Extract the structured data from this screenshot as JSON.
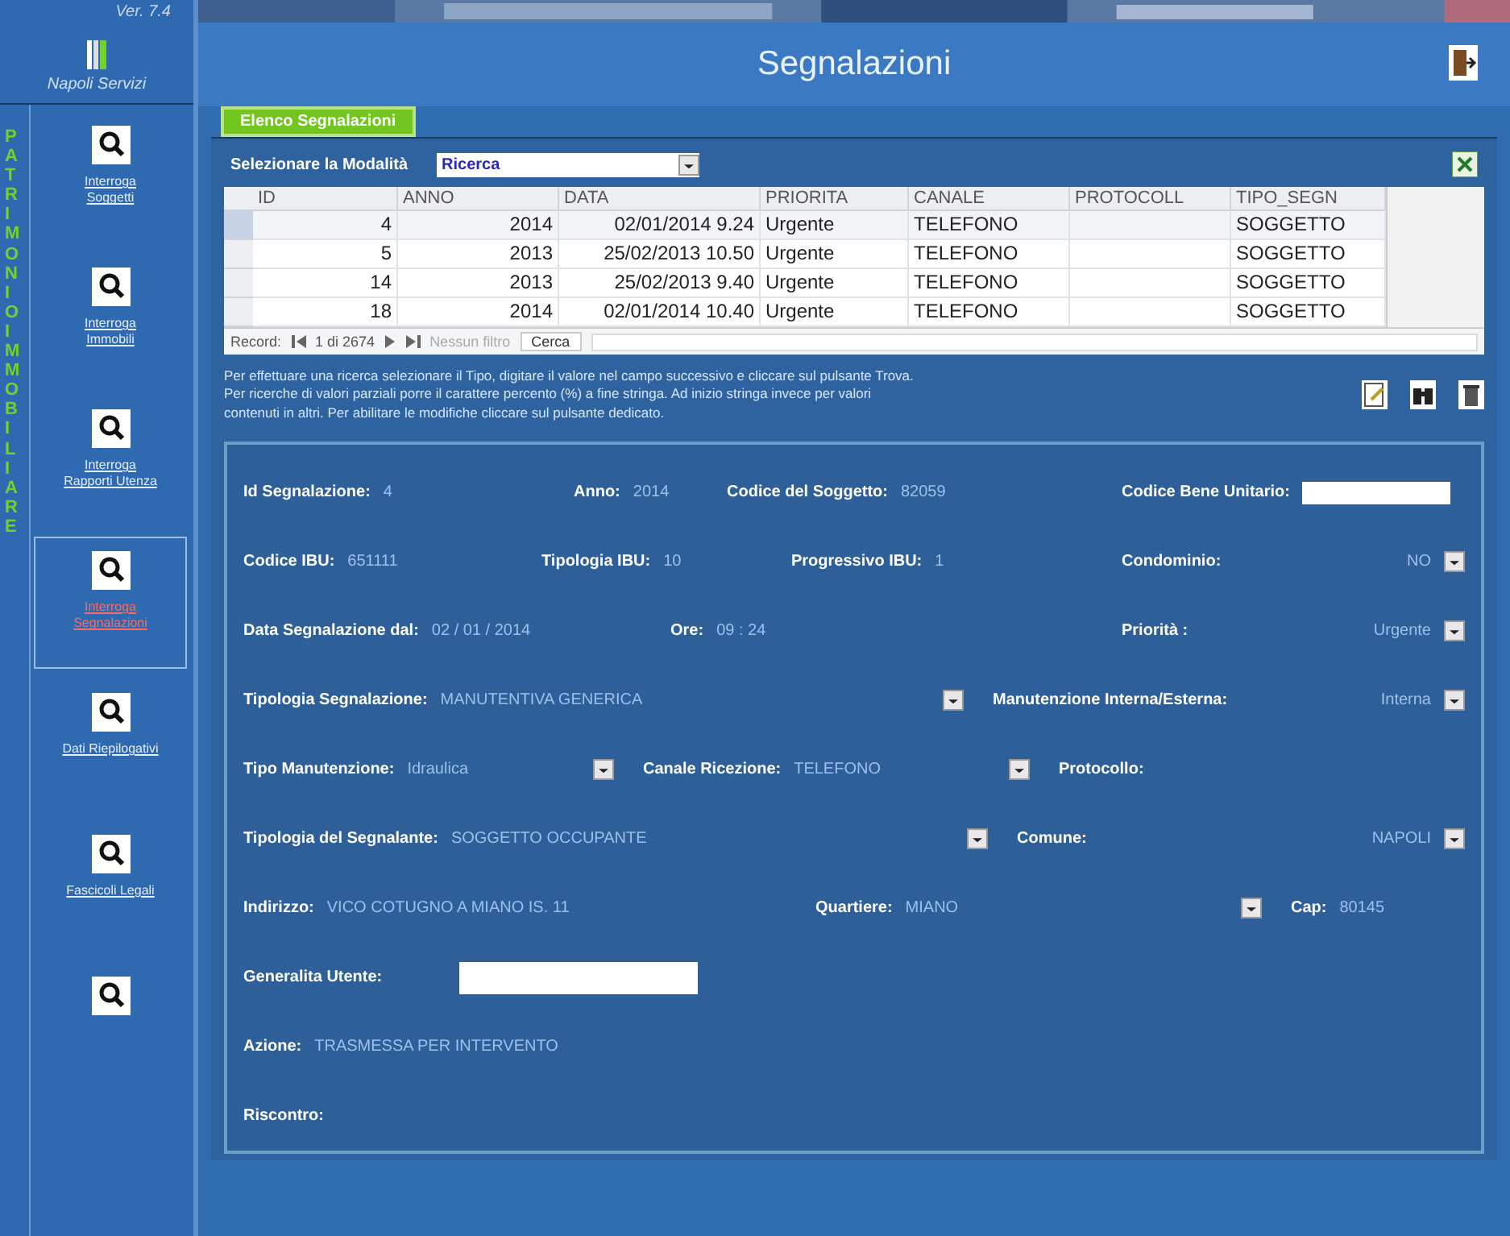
{
  "sidebar": {
    "version": "Ver. 7.4",
    "brand": "Napoli Servizi",
    "vertical_label": "PATRIMONIO IMMOBILIARE",
    "items": [
      {
        "label": "Interroga Soggetti",
        "selected": false
      },
      {
        "label": "Interroga Immobili",
        "selected": false
      },
      {
        "label": "Interroga Rapporti Utenza",
        "selected": false
      },
      {
        "label": "Interroga Segnalazioni",
        "selected": true
      },
      {
        "label": "Dati Riepilogativi",
        "selected": false
      },
      {
        "label": "Fascicoli Legali",
        "selected": false
      },
      {
        "selected": false
      }
    ]
  },
  "title": "Segnalazioni",
  "tab": "Elenco Segnalazioni",
  "mode": {
    "label": "Selezionare la Modalità",
    "value": "Ricerca"
  },
  "table": {
    "columns": [
      "ID",
      "ANNO",
      "DATA",
      "PRIORITA",
      "CANALE",
      "PROTOCOLL",
      "TIPO_SEGN"
    ],
    "rows": [
      {
        "cells": [
          "4",
          "2014",
          "02/01/2014 9.24",
          "Urgente",
          "TELEFONO",
          "",
          "SOGGETTO"
        ],
        "selected": true
      },
      {
        "cells": [
          "5",
          "2013",
          "25/02/2013 10.50",
          "Urgente",
          "TELEFONO",
          "",
          "SOGGETTO"
        ],
        "selected": false
      },
      {
        "cells": [
          "14",
          "2013",
          "25/02/2013 9.40",
          "Urgente",
          "TELEFONO",
          "",
          "SOGGETTO"
        ],
        "selected": false
      },
      {
        "cells": [
          "18",
          "2014",
          "02/01/2014 10.40",
          "Urgente",
          "TELEFONO",
          "",
          "SOGGETTO"
        ],
        "selected": false
      }
    ],
    "nav": {
      "label": "Record:",
      "position": "1 di 2674",
      "filter": "Nessun filtro",
      "search": "Cerca"
    }
  },
  "help": [
    "Per effettuare una ricerca selezionare il Tipo, digitare il valore nel campo successivo e cliccare sul pulsante Trova.",
    "Per ricerche di valori parziali porre il carattere percento (%) a fine stringa. Ad inizio stringa invece per valori",
    "contenuti in altri. Per abilitare le modifiche cliccare sul pulsante dedicato."
  ],
  "form": [
    [
      {
        "label": "Id Segnalazione:",
        "value": "4",
        "kind": "text"
      },
      {
        "label": "Anno:",
        "value": "2014",
        "kind": "text"
      },
      {
        "label": "Codice del Soggetto:",
        "value": "82059",
        "kind": "text"
      },
      {
        "label": "Codice Bene Unitario:",
        "kind": "input"
      }
    ],
    [
      {
        "label": "Codice IBU:",
        "value": "651111",
        "kind": "text"
      },
      {
        "label": "Tipologia IBU:",
        "value": "10",
        "kind": "text"
      },
      {
        "label": "Progressivo IBU:",
        "value": "1",
        "kind": "text"
      },
      {
        "label": "Condominio:",
        "value": "NO",
        "kind": "select"
      }
    ],
    [
      {
        "label": "Data Segnalazione dal:",
        "value": "02 / 01 / 2014",
        "kind": "text"
      },
      {
        "label": "Ore:",
        "value": "09 : 24",
        "kind": "text"
      },
      {
        "label": "Priorità :",
        "value": "Urgente",
        "kind": "select"
      }
    ],
    [
      {
        "label": "Tipologia  Segnalazione:",
        "value": "MANUTENTIVA GENERICA",
        "kind": "select"
      },
      {
        "label": "Manutenzione Interna/Esterna:",
        "value": "Interna",
        "kind": "select"
      }
    ],
    [
      {
        "label": "Tipo Manutenzione:",
        "value": "Idraulica",
        "kind": "select"
      },
      {
        "label": "Canale Ricezione:",
        "value": "TELEFONO",
        "kind": "select"
      },
      {
        "label": "Protocollo:",
        "kind": "text"
      }
    ],
    [
      {
        "label": "Tipologia del Segnalante:",
        "value": "SOGGETTO OCCUPANTE",
        "kind": "select"
      },
      {
        "label": "Comune:",
        "value": "NAPOLI",
        "kind": "select"
      }
    ],
    [
      {
        "label": "Indirizzo:",
        "value": "VICO COTUGNO A MIANO IS. 11",
        "kind": "text"
      },
      {
        "label": "Quartiere:",
        "value": "MIANO",
        "kind": "select"
      },
      {
        "label": "Cap:",
        "value": "80145",
        "kind": "text"
      }
    ],
    [
      {
        "label": "Generalita Utente:",
        "kind": "input"
      }
    ],
    [
      {
        "label": "Azione:",
        "value": "TRASMESSA PER INTERVENTO",
        "kind": "text"
      }
    ],
    [
      {
        "label": "Riscontro:",
        "kind": "text"
      }
    ]
  ]
}
